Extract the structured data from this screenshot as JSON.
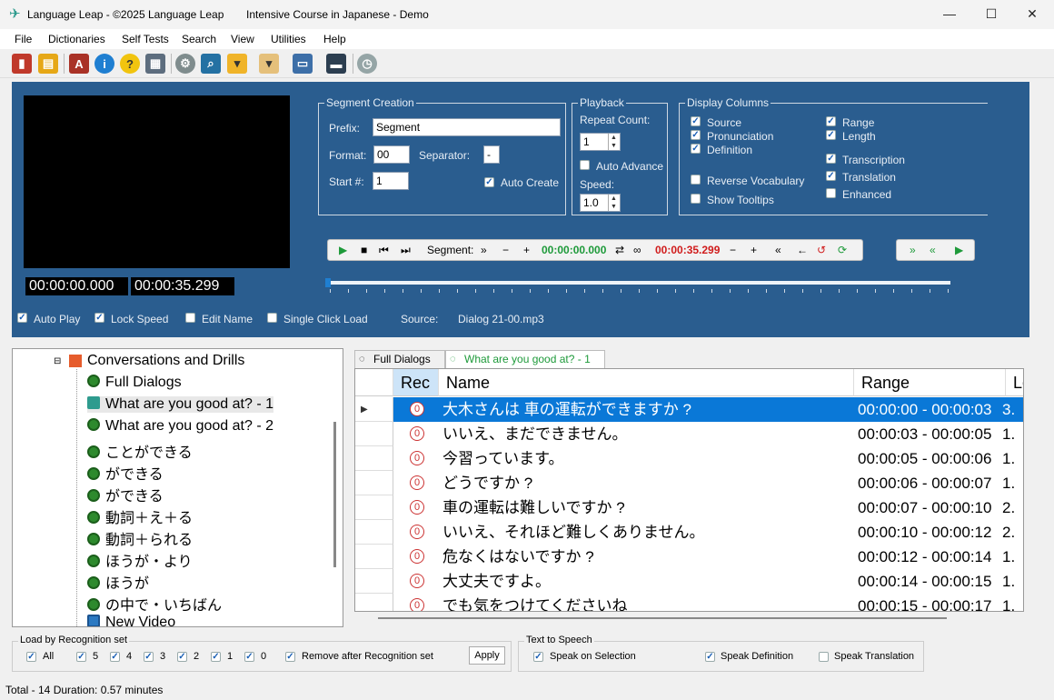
{
  "window": {
    "title": "Language Leap - ©2025 Language Leap",
    "course": "Intensive Course in Japanese - Demo"
  },
  "menu": [
    "File",
    "Dictionaries",
    "Self Tests",
    "Search",
    "View",
    "Utilities",
    "Help"
  ],
  "toolbar_icons": [
    "book-icon",
    "tree-icon",
    "dictionary-icon",
    "info-icon",
    "help-icon",
    "calendar-icon",
    "settings-icon",
    "search-window-icon",
    "folder-icon",
    "disk-icon",
    "display-icon",
    "screen-icon",
    "timer-icon"
  ],
  "media": {
    "start_time": "00:00:00.000",
    "end_time": "00:00:35.299"
  },
  "segment_creation": {
    "caption": "Segment Creation",
    "prefix_label": "Prefix:",
    "prefix_value": "Segment",
    "format_label": "Format:",
    "format_value": "00",
    "separator_label": "Separator:",
    "separator_value": "-",
    "start_label": "Start #:",
    "start_value": "1",
    "auto_create_label": "Auto Create"
  },
  "playback": {
    "caption": "Playback",
    "repeat_label": "Repeat Count:",
    "repeat_value": "1",
    "auto_advance_label": "Auto Advance",
    "speed_label": "Speed:",
    "speed_value": "1.0"
  },
  "display_columns": {
    "caption": "Display Columns",
    "source": "Source",
    "pronunciation": "Pronunciation",
    "definition": "Definition",
    "reverse_vocabulary": "Reverse Vocabulary",
    "show_tooltips": "Show Tooltips",
    "range": "Range",
    "length": "Length",
    "transcription": "Transcription",
    "translation": "Translation",
    "enhanced": "Enhanced"
  },
  "transport": {
    "segment_label": "Segment:",
    "segment_start": "00:00:00.000",
    "segment_end": "00:00:35.299"
  },
  "options": {
    "auto_play": "Auto Play",
    "lock_speed": "Lock Speed",
    "edit_name": "Edit Name",
    "single_click_load": "Single Click Load",
    "source_label": "Source:",
    "source_value": "Dialog 21-00.mp3"
  },
  "tree": {
    "root": "Conversations and Drills",
    "items": [
      "Full Dialogs",
      "What are you good at? - 1",
      "What are you good at? - 2",
      "ことができる",
      "ができる",
      "ができる",
      "動詞＋え＋る",
      "動詞＋られる",
      "ほうが・より",
      "ほうが",
      "の中で・いちばん",
      "New Video"
    ]
  },
  "tabs": [
    "Full Dialogs",
    "What are you good at? - 1"
  ],
  "grid": {
    "headers": [
      "Rec",
      "Name",
      "Range",
      "Le"
    ],
    "rows": [
      {
        "rec": "0",
        "name": "大木さんは 車の運転ができますか ?",
        "range": "00:00:00 - 00:00:03",
        "len": "3."
      },
      {
        "rec": "0",
        "name": "いいえ、まだできません。",
        "range": "00:00:03 - 00:00:05",
        "len": "1."
      },
      {
        "rec": "0",
        "name": "今習っています。",
        "range": "00:00:05 - 00:00:06",
        "len": "1."
      },
      {
        "rec": "0",
        "name": "どうですか ?",
        "range": "00:00:06 - 00:00:07",
        "len": "1."
      },
      {
        "rec": "0",
        "name": "車の運転は難しいですか ?",
        "range": "00:00:07 - 00:00:10",
        "len": "2."
      },
      {
        "rec": "0",
        "name": "いいえ、それほど難しくありません。",
        "range": "00:00:10 - 00:00:12",
        "len": "2."
      },
      {
        "rec": "0",
        "name": "危なくはないですか ?",
        "range": "00:00:12 - 00:00:14",
        "len": "1."
      },
      {
        "rec": "0",
        "name": "大丈夫ですよ。",
        "range": "00:00:14 - 00:00:15",
        "len": "1."
      },
      {
        "rec": "0",
        "name": "でも気をつけてくださいね",
        "range": "00:00:15 - 00:00:17",
        "len": "1."
      }
    ]
  },
  "recognition": {
    "caption": "Load by Recognition set",
    "all": "All",
    "levels": [
      "5",
      "4",
      "3",
      "2",
      "1",
      "0"
    ],
    "remove_label": "Remove after Recognition set",
    "apply": "Apply"
  },
  "tts": {
    "caption": "Text to Speech",
    "speak_selection": "Speak  on Selection",
    "speak_definition": "Speak Definition",
    "speak_translation": "Speak Translation"
  },
  "status": "Total - 14  Duration: 0.57 minutes",
  "colors": {
    "panel": "#2a5d8f",
    "selection": "#0a78d7",
    "green_time": "#1e9a3a",
    "red_time": "#d01c1c"
  }
}
